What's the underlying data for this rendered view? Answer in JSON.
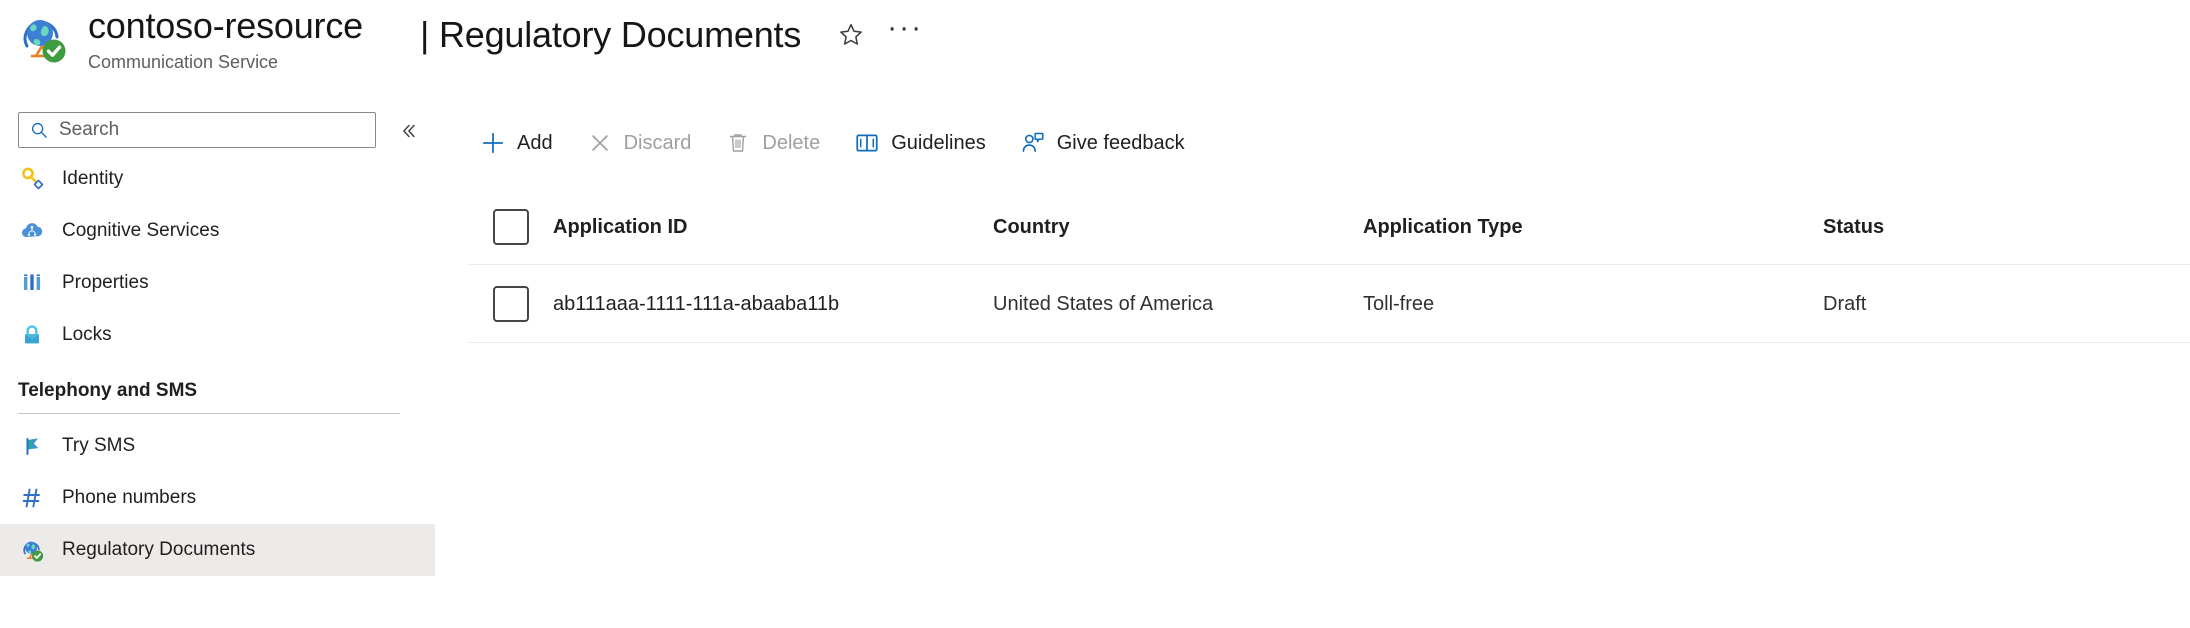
{
  "header": {
    "resource_icon": "globe-check-icon",
    "resource_name": "contoso-resource",
    "resource_subtitle": "Communication Service",
    "page_title": "| Regulatory Documents",
    "favorite_icon": "star-outline-icon",
    "more_label": "···"
  },
  "sidebar": {
    "search": {
      "placeholder": "Search",
      "value": "",
      "icon": "search-icon"
    },
    "collapse_icon": "double-chevron-left-icon",
    "items": [
      {
        "label": "Identity",
        "icon": "key-icon",
        "selected": false
      },
      {
        "label": "Cognitive Services",
        "icon": "cognitive-cloud-icon",
        "selected": false
      },
      {
        "label": "Properties",
        "icon": "properties-bars-icon",
        "selected": false
      },
      {
        "label": "Locks",
        "icon": "lock-icon",
        "selected": false
      }
    ],
    "group": {
      "title": "Telephony and SMS",
      "items": [
        {
          "label": "Try SMS",
          "icon": "flag-icon",
          "selected": false
        },
        {
          "label": "Phone numbers",
          "icon": "hash-icon",
          "selected": false
        },
        {
          "label": "Regulatory Documents",
          "icon": "globe-check-icon",
          "selected": true
        }
      ]
    }
  },
  "toolbar": {
    "buttons": [
      {
        "label": "Add",
        "icon": "plus-icon",
        "disabled": false
      },
      {
        "label": "Discard",
        "icon": "close-x-icon",
        "disabled": true
      },
      {
        "label": "Delete",
        "icon": "trash-icon",
        "disabled": true
      },
      {
        "label": "Guidelines",
        "icon": "book-icon",
        "disabled": false
      },
      {
        "label": "Give feedback",
        "icon": "person-feedback-icon",
        "disabled": false
      }
    ]
  },
  "table": {
    "select_all_icon": "checkbox-unchecked-icon",
    "columns": [
      "Application ID",
      "Country",
      "Application Type",
      "Status"
    ],
    "rows": [
      {
        "checkbox": "checkbox-unchecked-icon",
        "application_id": "ab111aaa-1111-111a-abaaba11b",
        "country": "United States of America",
        "application_type": "Toll-free",
        "status": "Draft"
      }
    ]
  },
  "colors": {
    "accent": "#0078d4",
    "text": "#201f1e",
    "muted": "#605e5c",
    "disabled": "#a19f9d",
    "selected_bg": "#edebe9",
    "border": "#edebe9"
  }
}
